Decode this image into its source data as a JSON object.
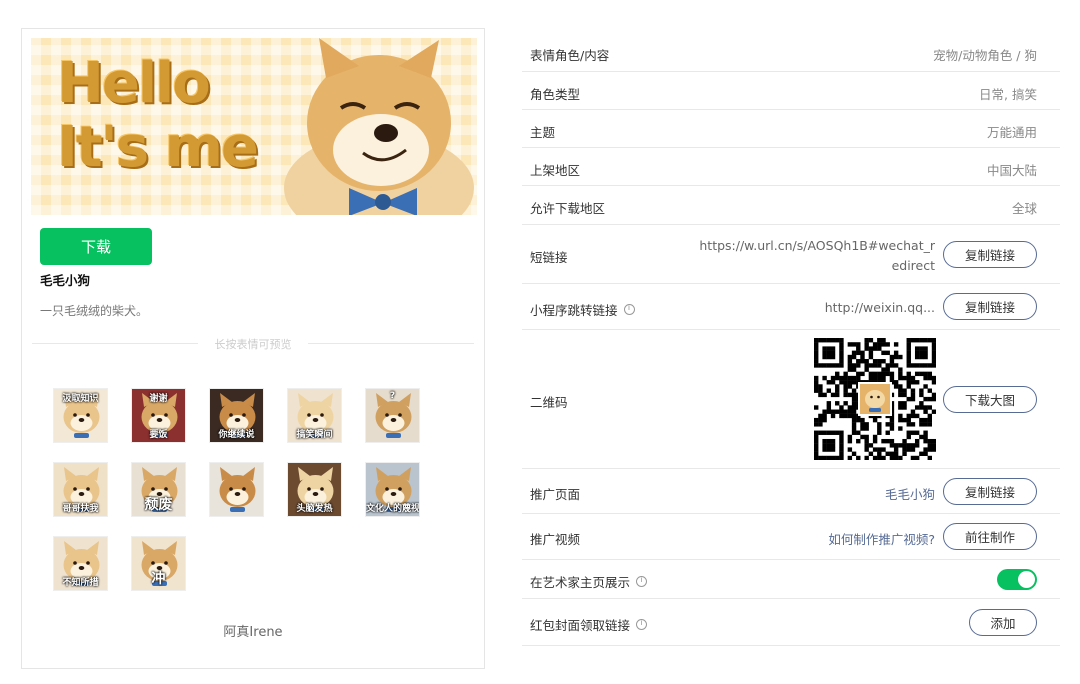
{
  "banner": {
    "line1": "Hello",
    "line2": "It's me"
  },
  "left": {
    "download_label": "下载",
    "sticker_name": "毛毛小狗",
    "sticker_desc": "一只毛绒绒的柴犬。",
    "preview_hint": "长按表情可预览",
    "author": "阿真Irene",
    "stickers": [
      {
        "label": "汲取知识",
        "pos": "top"
      },
      {
        "label": "要饭",
        "pos": "bottom",
        "extra": "谢谢"
      },
      {
        "label": "你继续说",
        "pos": "bottom"
      },
      {
        "label": "搞笑瞬间",
        "pos": "bottom"
      },
      {
        "label": "?",
        "pos": "top"
      },
      {
        "label": "哥哥扶我",
        "pos": "bottom"
      },
      {
        "label": "颓废",
        "pos": "bottom",
        "big": true
      },
      {
        "label": "",
        "pos": "bottom"
      },
      {
        "label": "头脑发热",
        "pos": "bottom"
      },
      {
        "label": "文化人的蔑视",
        "pos": "bottom"
      },
      {
        "label": "不知所措",
        "pos": "bottom"
      },
      {
        "label": "冲",
        "pos": "bottom",
        "big": true
      }
    ]
  },
  "info": {
    "content_label": "表情角色/内容",
    "content_value": "宠物/动物角色 / 狗",
    "role_type_label": "角色类型",
    "role_type_value": "日常, 搞笑",
    "theme_label": "主题",
    "theme_value": "万能通用",
    "region_label": "上架地区",
    "region_value": "中国大陆",
    "download_region_label": "允许下载地区",
    "download_region_value": "全球",
    "short_link_label": "短链接",
    "short_link_line1": "https://w.url.cn/s/AOSQh1B#wechat_r",
    "short_link_line2": "edirect",
    "mini_program_label": "小程序跳转链接",
    "mini_program_value": "http://weixin.qq...",
    "qr_label": "二维码",
    "promo_page_label": "推广页面",
    "promo_page_value": "毛毛小狗",
    "promo_video_label": "推广视频",
    "promo_video_value": "如何制作推广视频?",
    "artist_show_label": "在艺术家主页展示",
    "red_packet_label": "红包封面领取链接"
  },
  "buttons": {
    "copy_link": "复制链接",
    "download_big": "下载大图",
    "go_make": "前往制作",
    "add": "添加"
  },
  "toggle": {
    "artist_show": true
  },
  "colors": {
    "accent_green": "#07c160",
    "link_blue": "#576b95"
  }
}
